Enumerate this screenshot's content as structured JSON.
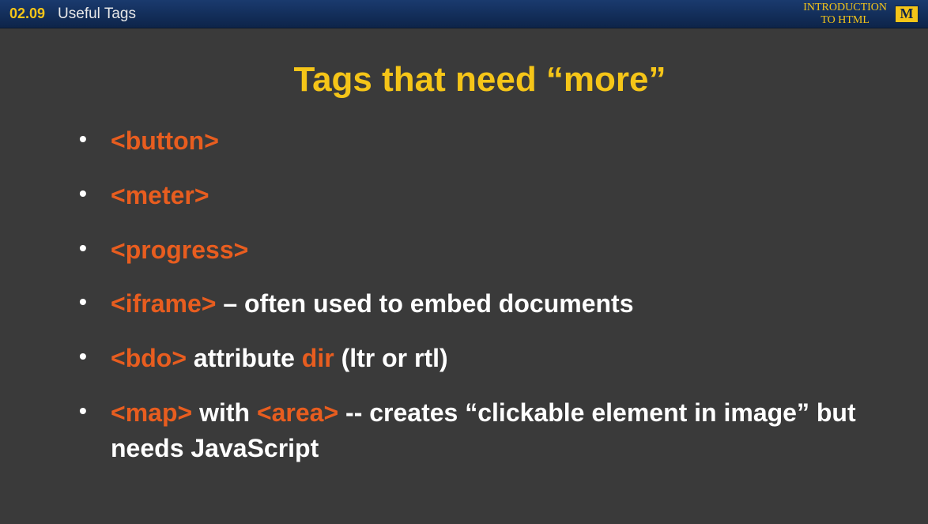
{
  "header": {
    "slide_number": "02.09",
    "slide_title": "Useful Tags",
    "course_line1": "INTRODUCTION",
    "course_line2": "TO HTML",
    "logo_text": "M"
  },
  "main_title": "Tags that need “more”",
  "bullets": [
    {
      "tag": "<button>"
    },
    {
      "tag": "<meter>"
    },
    {
      "tag": "<progress>"
    },
    {
      "tag": "<iframe>",
      "after": " – often used to embed documents"
    },
    {
      "tag": "<bdo>",
      "mid": " attribute ",
      "attr": "dir",
      "after": " (ltr or rtl)"
    },
    {
      "tag": "<map>",
      "mid": " with ",
      "tag2": "<area>",
      "after": " -- creates “clickable element in image” but needs JavaScript"
    }
  ]
}
